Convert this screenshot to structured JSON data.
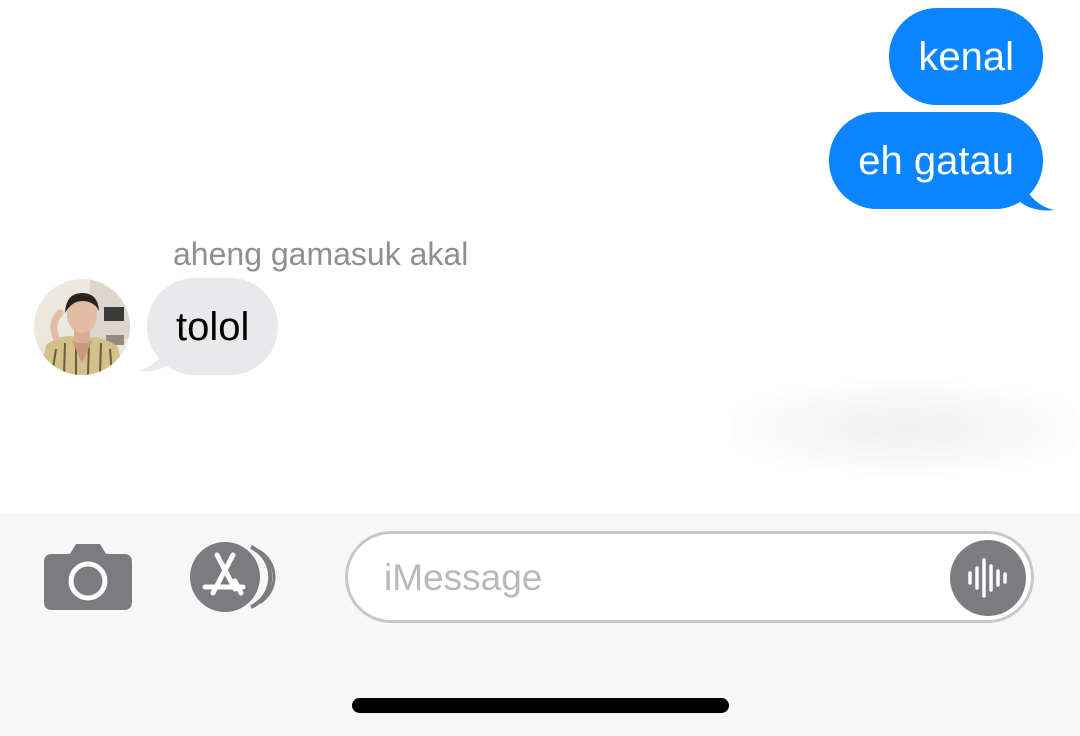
{
  "conversation": {
    "sent_messages": [
      "kenal",
      "eh gatau"
    ],
    "received": {
      "sender_name": "aheng gamasuk akal",
      "message": "tolol"
    }
  },
  "composer": {
    "placeholder": "iMessage",
    "value": ""
  },
  "icons": {
    "camera": "camera-icon",
    "apps": "app-store-icon",
    "audio": "audio-waveform-icon"
  },
  "colors": {
    "sent_bubble": "#0a84ff",
    "received_bubble": "#e9e9eb",
    "sender_name": "#8e8e93",
    "icon_gray": "#7c7c80"
  }
}
